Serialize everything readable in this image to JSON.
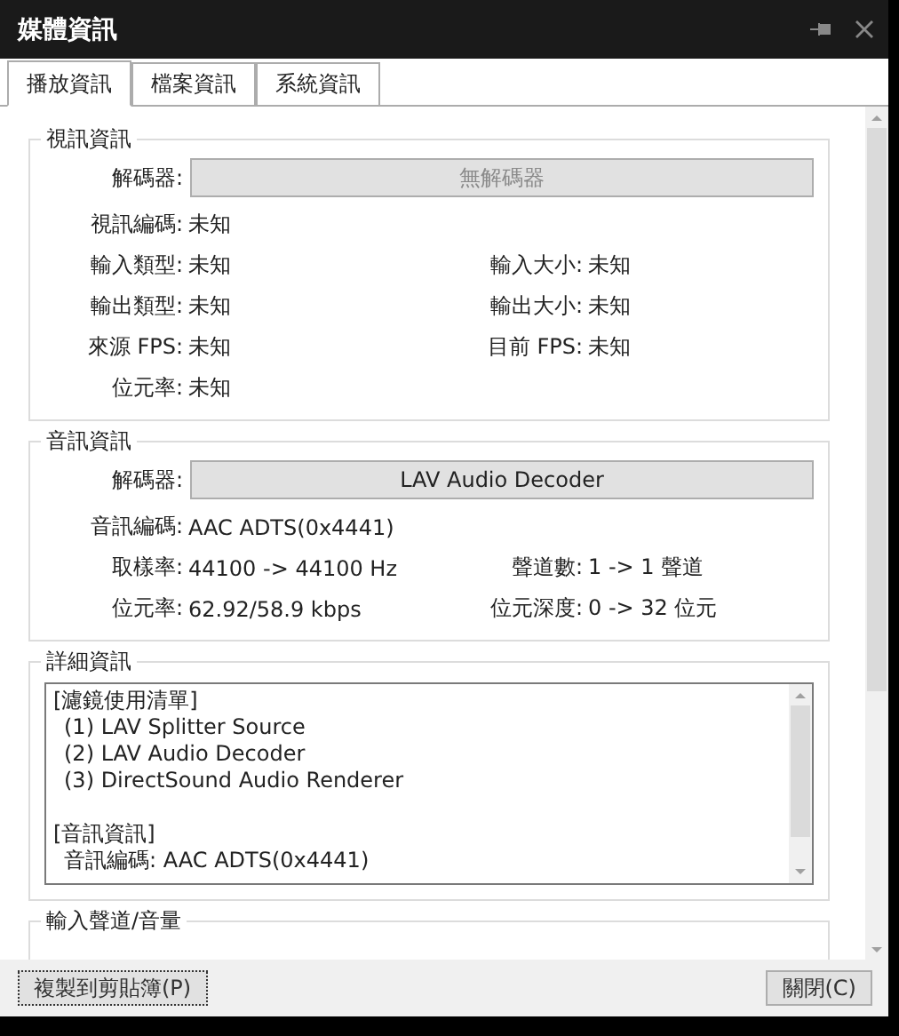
{
  "window": {
    "title": "媒體資訊"
  },
  "tabs": [
    {
      "label": "播放資訊",
      "selected": true
    },
    {
      "label": "檔案資訊",
      "selected": false
    },
    {
      "label": "系統資訊",
      "selected": false
    }
  ],
  "video": {
    "title": "視訊資訊",
    "decoder_label": "解碼器:",
    "decoder": {
      "label": "無解碼器",
      "disabled": true
    },
    "rows": [
      [
        {
          "label": "視訊編碼:",
          "value": "未知"
        }
      ],
      [
        {
          "label": "輸入類型:",
          "value": "未知"
        },
        {
          "label": "輸入大小:",
          "value": "未知"
        }
      ],
      [
        {
          "label": "輸出類型:",
          "value": "未知"
        },
        {
          "label": "輸出大小:",
          "value": "未知"
        }
      ],
      [
        {
          "label": "來源 FPS:",
          "value": "未知"
        },
        {
          "label": "目前 FPS:",
          "value": "未知"
        }
      ],
      [
        {
          "label": "位元率:",
          "value": "未知"
        }
      ]
    ]
  },
  "audio": {
    "title": "音訊資訊",
    "decoder_label": "解碼器:",
    "decoder": {
      "label": "LAV Audio Decoder",
      "disabled": false
    },
    "rows": [
      [
        {
          "label": "音訊編碼:",
          "value": "AAC ADTS(0x4441)"
        }
      ],
      [
        {
          "label": "取樣率:",
          "value": "44100 -> 44100 Hz"
        },
        {
          "label": "聲道數:",
          "value": "1 -> 1 聲道"
        }
      ],
      [
        {
          "label": "位元率:",
          "value": "62.92/58.9 kbps"
        },
        {
          "label": "位元深度:",
          "value": "0 -> 32 位元"
        }
      ]
    ]
  },
  "details": {
    "title": "詳細資訊",
    "sections": [
      {
        "header": "[濾鏡使用清單]",
        "children": [
          "(1) LAV Splitter Source",
          "(2) LAV Audio Decoder",
          "(3) DirectSound Audio Renderer"
        ]
      },
      {
        "header": "[音訊資訊]",
        "children": [
          "音訊編碼: AAC ADTS(0x4441)"
        ]
      }
    ]
  },
  "channels": {
    "title": "輸入聲道/音量"
  },
  "footer": {
    "copy_button": "複製到剪貼簿(P)",
    "close_button": "關閉(C)"
  }
}
